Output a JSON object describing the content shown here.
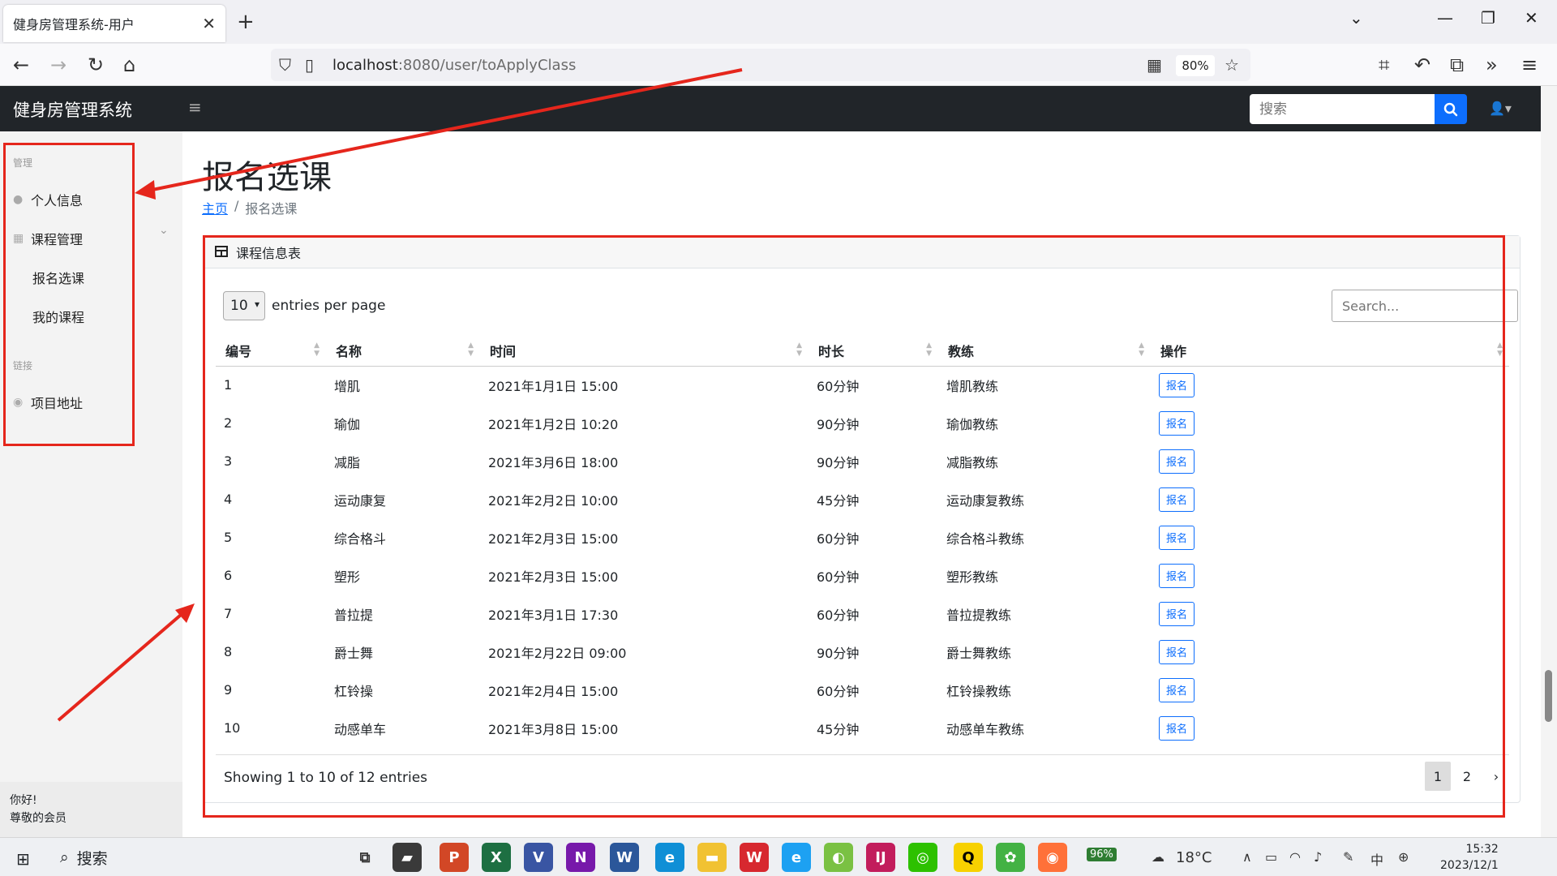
{
  "browser": {
    "tab_title": "健身房管理系统-用户",
    "tab_close": "✕",
    "new_tab": "+",
    "url_host": "localhost",
    "url_rest": ":8080/user/toApplyClass",
    "zoom": "80%"
  },
  "header": {
    "brand": "健身房管理系统",
    "search_placeholder": "搜索"
  },
  "sidebar": {
    "heading_manage": "管理",
    "item_profile": "个人信息",
    "item_course": "课程管理",
    "sub_apply": "报名选课",
    "sub_mine": "我的课程",
    "heading_links": "链接",
    "item_project": "项目地址",
    "footer_line1": "你好!",
    "footer_line2": "尊敬的会员"
  },
  "main": {
    "title": "报名选课",
    "breadcrumb_home": "主页",
    "breadcrumb_sep": "/",
    "breadcrumb_current": "报名选课",
    "card_title": "课程信息表",
    "page_size": "10",
    "entries_label": "entries per page",
    "search_placeholder": "Search...",
    "columns": [
      "编号",
      "名称",
      "时间",
      "时长",
      "教练",
      "操作"
    ],
    "apply_label": "报名",
    "rows": [
      [
        "1",
        "增肌",
        "2021年1月1日 15:00",
        "60分钟",
        "增肌教练"
      ],
      [
        "2",
        "瑜伽",
        "2021年1月2日 10:20",
        "90分钟",
        "瑜伽教练"
      ],
      [
        "3",
        "减脂",
        "2021年3月6日 18:00",
        "90分钟",
        "减脂教练"
      ],
      [
        "4",
        "运动康复",
        "2021年2月2日 10:00",
        "45分钟",
        "运动康复教练"
      ],
      [
        "5",
        "综合格斗",
        "2021年2月3日 15:00",
        "60分钟",
        "综合格斗教练"
      ],
      [
        "6",
        "塑形",
        "2021年2月3日 15:00",
        "60分钟",
        "塑形教练"
      ],
      [
        "7",
        "普拉提",
        "2021年3月1日 17:30",
        "60分钟",
        "普拉提教练"
      ],
      [
        "8",
        "爵士舞",
        "2021年2月22日 09:00",
        "90分钟",
        "爵士舞教练"
      ],
      [
        "9",
        "杠铃操",
        "2021年2月4日 15:00",
        "60分钟",
        "杠铃操教练"
      ],
      [
        "10",
        "动感单车",
        "2021年3月8日 15:00",
        "45分钟",
        "动感单车教练"
      ]
    ],
    "info": "Showing 1 to 10 of 12 entries",
    "pages": [
      "1",
      "2"
    ],
    "next": "›"
  },
  "taskbar": {
    "search_label": "搜索",
    "battery": "96%",
    "temperature": "18°C",
    "time": "15:32",
    "date": "2023/12/1"
  },
  "colors": {
    "primary": "#0d6efd",
    "navbar": "#212529",
    "annotation": "#e5261c"
  }
}
